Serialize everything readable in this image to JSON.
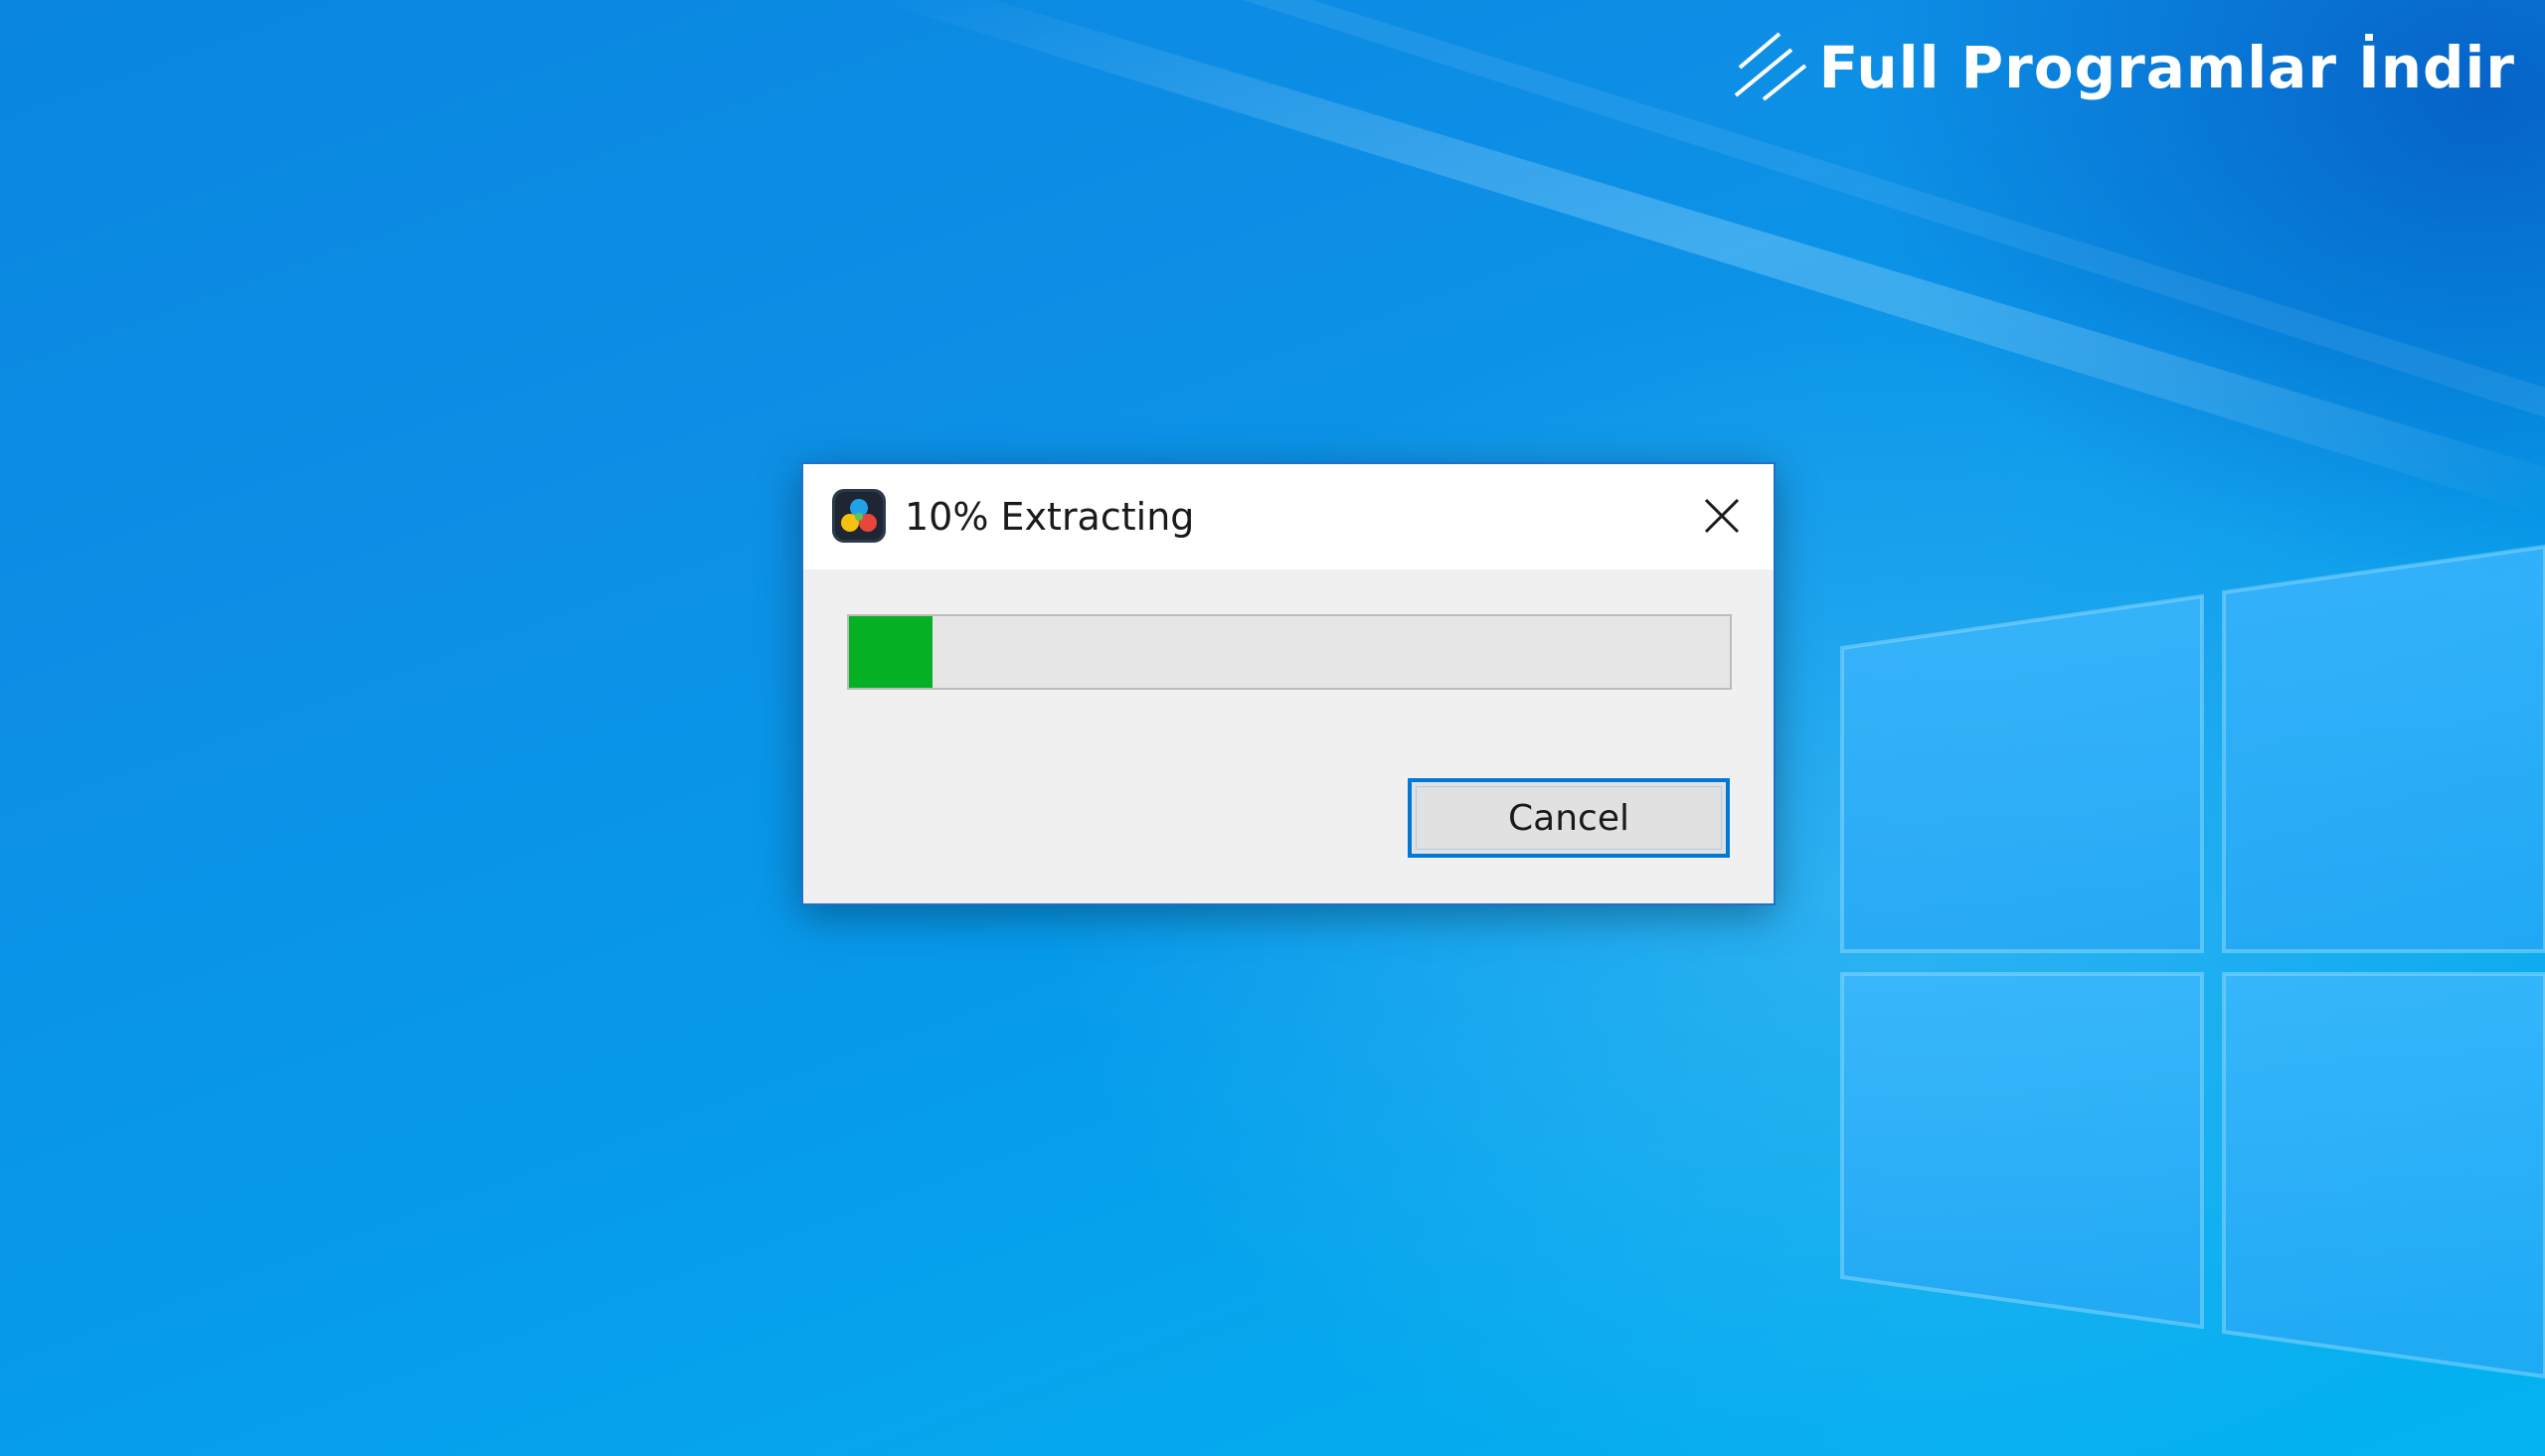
{
  "watermark": {
    "text": "Full Programlar İndir"
  },
  "dialog": {
    "title": "10% Extracting",
    "progress_fraction": 0.095,
    "progress_color": "#06b025",
    "cancel_label": "Cancel",
    "icons": {
      "app": "davinci-resolve-icon",
      "close": "close-icon"
    }
  },
  "desktop": {
    "wallpaper": "windows-10-hero-blue",
    "accent": "#0078d7"
  }
}
